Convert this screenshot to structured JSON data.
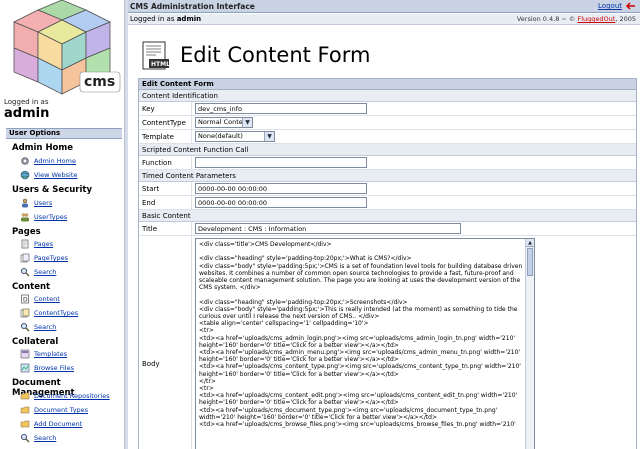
{
  "app": {
    "title": "CMS Administration Interface",
    "logout_label": "Logout",
    "logged_in_prefix": "Logged in as",
    "logged_in_user": "admin",
    "version_text": "Version 0.4.8 ~ © ",
    "version_link": "FluggedOut",
    "version_year": ", 2005"
  },
  "logo": {
    "text": "cms"
  },
  "sidebar": {
    "logged_in_label": "Logged in as",
    "user": "admin",
    "options_title": "User Options",
    "groups": [
      {
        "title": "Admin Home",
        "items": [
          {
            "label": "Admin Home",
            "icon": "gear-icon"
          },
          {
            "label": "View Website",
            "icon": "globe-icon"
          }
        ]
      },
      {
        "title": "Users & Security",
        "items": [
          {
            "label": "Users",
            "icon": "users-icon"
          },
          {
            "label": "UserTypes",
            "icon": "usertypes-icon"
          }
        ]
      },
      {
        "title": "Pages",
        "items": [
          {
            "label": "Pages",
            "icon": "page-icon"
          },
          {
            "label": "PageTypes",
            "icon": "pagetypes-icon"
          },
          {
            "label": "Search",
            "icon": "search-icon"
          }
        ]
      },
      {
        "title": "Content",
        "items": [
          {
            "label": "Content",
            "icon": "content-icon"
          },
          {
            "label": "ContentTypes",
            "icon": "contenttypes-icon"
          },
          {
            "label": "Search",
            "icon": "search-icon"
          }
        ]
      },
      {
        "title": "Collateral",
        "items": [
          {
            "label": "Templates",
            "icon": "templates-icon"
          },
          {
            "label": "Browse Files",
            "icon": "files-icon"
          }
        ]
      },
      {
        "title": "Document Management",
        "items": [
          {
            "label": "Document Repositories",
            "icon": "folder-icon"
          },
          {
            "label": "Document Types",
            "icon": "folder-icon"
          },
          {
            "label": "Add Document",
            "icon": "folder-icon"
          },
          {
            "label": "Search",
            "icon": "search-icon"
          }
        ]
      }
    ]
  },
  "page": {
    "heading": "Edit Content Form",
    "icon": "html-document-icon",
    "icon_label": "HTML"
  },
  "form": {
    "title": "Edit Content Form",
    "sections": {
      "identification": "Content Identification",
      "scripted": "Scripted Content Function Call",
      "timed": "Timed Content Parameters",
      "basic": "Basic Content"
    },
    "fields": {
      "key": {
        "label": "Key",
        "value": "dev_cms_info"
      },
      "content_type": {
        "label": "ContentType",
        "value": "Normal Content"
      },
      "template": {
        "label": "Template",
        "value": "None(default)"
      },
      "function": {
        "label": "Function",
        "value": ""
      },
      "start": {
        "label": "Start",
        "value": "0000-00-00 00:00:00"
      },
      "end": {
        "label": "End",
        "value": "0000-00-00 00:00:00"
      },
      "title": {
        "label": "Title",
        "value": "Development : CMS : Information"
      },
      "body": {
        "label": "Body",
        "value": "<div class='title'>CMS Development</div>\n\n<div class=\"heading\" style='padding-top:20px;'>What is CMS?</div>\n<div class=\"body\" style='padding:5px;'>CMS is a set of foundation level tools for building database driven websites. It combines a number of common open source technologies to provide a fast, future-proof and scaleable content management solution. The page you are looking at uses the development version of the CMS system. </div>\n\n<div class=\"heading\" style='padding-top:20px;'>Screenshots</div>\n<div class=\"body\" style='padding:5px;'>This is really intended (at the moment) as something to tide the curious over until I release the next version of CMS.. </div>\n<table align='center' cellspacing='1' cellpadding='10'>\n<tr>\n<td><a href='uploads/cms_admin_login.png'><img src='uploads/cms_admin_login_tn.png' width='210' height='160' border='0' title='Click for a better view'></a></td>\n<td><a href='uploads/cms_admin_menu.png'><img src='uploads/cms_admin_menu_tn.png' width='210' height='160' border='0' title='Click for a better view'></a></td>\n<td><a href='uploads/cms_content_type.png'><img src='uploads/cms_content_type_tn.png' width='210' height='160' border='0' title='Click for a better view'></a></td>\n</tr>\n<tr>\n<td><a href='uploads/cms_content_edit.png'><img src='uploads/cms_content_edit_tn.png' width='210' height='160' border='0' title='Click for a better view'></a></td>\n<td><a href='uploads/cms_document_type.png'><img src='uploads/cms_document_type_tn.png' width='210' height='160' border='0' title='Click for a better view'></a></td>\n<td><a href='uploads/cms_browse_files.png'><img src='uploads/cms_browse_files_tn.png' width='210'"
      }
    }
  },
  "colors": {
    "header_bg": "#c9d3e3",
    "link": "#0033aa",
    "section_bg": "#e8ecf3"
  }
}
